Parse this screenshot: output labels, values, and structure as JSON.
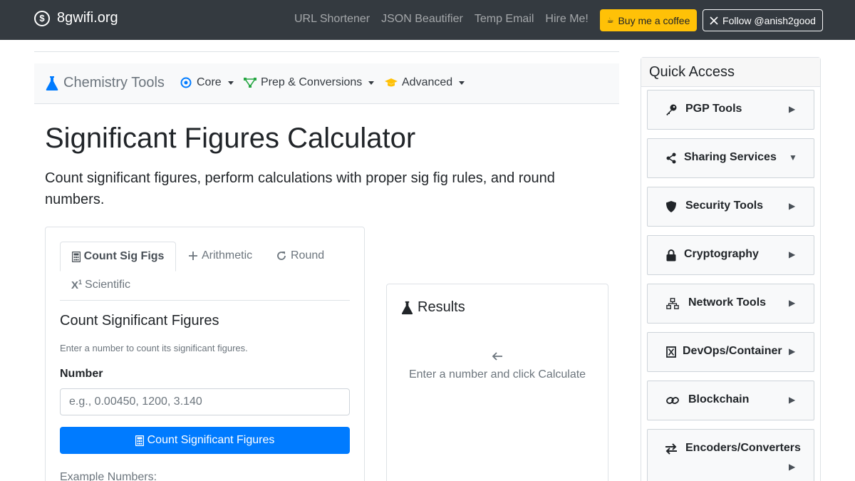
{
  "topnav": {
    "brand": "8gwifi.org",
    "brand_icon_glyph": "$",
    "links": [
      "URL Shortener",
      "JSON Beautifier",
      "Temp Email",
      "Hire Me!"
    ],
    "coffee_label": "Buy me a coffee",
    "follow_label": "Follow @anish2good"
  },
  "subnav": {
    "brand": "Chemistry Tools",
    "items": [
      {
        "label": "Core",
        "icon": "atom-icon"
      },
      {
        "label": "Prep & Conversions",
        "icon": "vector-icon"
      },
      {
        "label": "Advanced",
        "icon": "graduation-cap-icon"
      }
    ]
  },
  "page": {
    "title": "Significant Figures Calculator",
    "lead": "Count significant figures, perform calculations with proper sig fig rules, and round numbers."
  },
  "calculator": {
    "tabs": [
      {
        "label": "Count Sig Figs",
        "icon": "calculator-icon",
        "active": true
      },
      {
        "label": "Arithmetic",
        "icon": "plus-icon",
        "active": false
      },
      {
        "label": "Round",
        "icon": "redo-icon",
        "active": false
      },
      {
        "label": "Scientific",
        "icon": "superscript-icon",
        "active": false
      }
    ],
    "heading": "Count Significant Figures",
    "help": "Enter a number to count its significant figures.",
    "input_label": "Number",
    "input_placeholder": "e.g., 0.00450, 1200, 3.140",
    "input_value": "",
    "button_label": "Count Significant Figures",
    "examples_label": "Example Numbers:"
  },
  "results": {
    "title": "Results",
    "empty_message": "Enter a number and click Calculate"
  },
  "sidebar": {
    "title": "Quick Access",
    "items": [
      {
        "label": "PGP Tools",
        "icon": "key-icon",
        "arrow": "▶"
      },
      {
        "label": "Sharing Services",
        "icon": "share-icon",
        "arrow": "▼"
      },
      {
        "label": "Security Tools",
        "icon": "shield-icon",
        "arrow": "▶"
      },
      {
        "label": "Cryptography",
        "icon": "lock-icon",
        "arrow": "▶"
      },
      {
        "label": "Network Tools",
        "icon": "network-icon",
        "arrow": "▶"
      },
      {
        "label": "DevOps/Container",
        "icon": "container-icon",
        "arrow": "▶"
      },
      {
        "label": "Blockchain",
        "icon": "link-icon",
        "arrow": "▶"
      },
      {
        "label": "Encoders/Converters",
        "icon": "exchange-icon",
        "arrow": "▶"
      }
    ]
  },
  "colors": {
    "navbar": "#343a40",
    "primary": "#007bff",
    "warning": "#ffc107",
    "chem_icon_blue": "#007bff",
    "prep_icon_green": "#28a745",
    "advanced_icon_gold": "#ffc107"
  }
}
